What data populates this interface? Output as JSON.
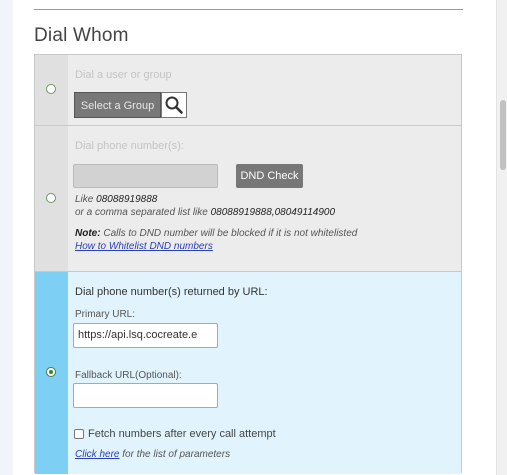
{
  "section": {
    "title": "Dial Whom"
  },
  "option_user_group": {
    "label": "Dial a user or group",
    "select_button": "Select a Group"
  },
  "option_phone": {
    "label": "Dial phone number(s):",
    "input_value": "",
    "dnd_button": "DND Check",
    "like_prefix": "Like",
    "like_example": "08088919888",
    "list_prefix": "or a comma separated list like",
    "list_example": "08088919888,08049114900",
    "note_label": "Note:",
    "note_text": "Calls to DND number will be blocked if it is not whitelisted",
    "whitelist_link": "How to Whitelist DND numbers"
  },
  "option_url": {
    "heading": "Dial phone number(s) returned by URL:",
    "primary_label": "Primary URL:",
    "primary_value": "https://api.lsq.cocreate.e",
    "fallback_label": "Fallback URL(Optional):",
    "fallback_value": "",
    "fetch_label": "Fetch numbers after every call attempt",
    "click_here": "Click here",
    "params_text": "for the list of parameters"
  },
  "selected_option": "option_url",
  "colors": {
    "selected_bg": "#e1f4fd",
    "selected_bar": "#7dcff4",
    "link": "#2b3fb5"
  }
}
